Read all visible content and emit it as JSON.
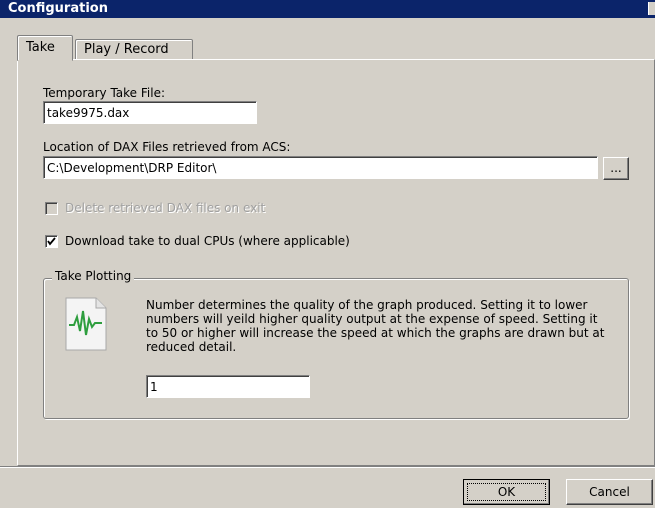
{
  "window": {
    "title": "Configuration"
  },
  "tabs": [
    {
      "label": "Take",
      "active": true
    },
    {
      "label": "Play / Record",
      "active": false
    }
  ],
  "take_tab": {
    "temp_file_label": "Temporary Take File:",
    "temp_file_value": "take9975.dax",
    "location_label": "Location of DAX Files retrieved from ACS:",
    "location_value": "C:\\Development\\DRP Editor\\",
    "browse_label": "...",
    "delete_checkbox": {
      "label": "Delete retrieved DAX files on exit",
      "checked": false,
      "enabled": false
    },
    "dual_cpu_checkbox": {
      "label": "Download take to dual CPUs (where applicable)",
      "checked": true,
      "enabled": true
    },
    "plotting": {
      "group_title": "Take Plotting",
      "icon": "graph-document-icon",
      "description": "Number determines the quality of the graph produced. Setting it to lower numbers will yeild higher quality output at the expense of speed. Setting it to 50 or higher will increase the speed at which the graphs are drawn but at reduced detail.",
      "value": "1"
    }
  },
  "buttons": {
    "ok": "OK",
    "cancel": "Cancel"
  },
  "colors": {
    "titlebar": "#0b246a",
    "face": "#d4d0c8",
    "graph_green": "#2e9e3e"
  }
}
